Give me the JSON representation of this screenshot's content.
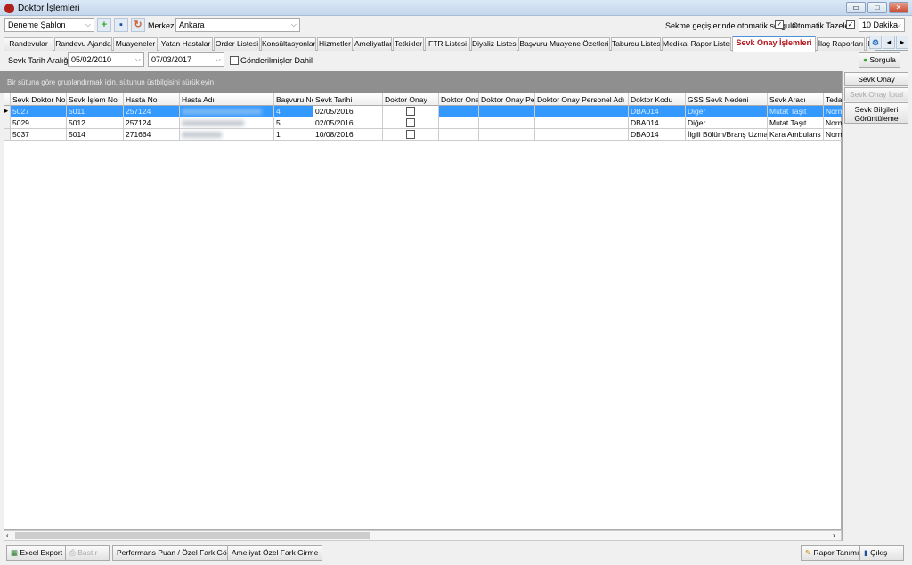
{
  "window": {
    "title": "Doktor İşlemleri",
    "minimize": "▭",
    "maximize": "□",
    "close": "✕"
  },
  "toolbar": {
    "template": "Deneme Şablon",
    "merkez_label": "Merkez:",
    "merkez_value": "Ankara",
    "auto_query_label": "Sekme geçişlerinde otomatik sorgula",
    "auto_query_checked": true,
    "auto_refresh_label": "Otomatik Tazele",
    "auto_refresh_checked": true,
    "refresh_interval": "10 Dakika"
  },
  "tabs": [
    "Randevular",
    "Randevu Ajanda",
    "Muayeneler",
    "Yatan Hastalar",
    "Order Listesi",
    "Konsültasyonlar",
    "Hizmetler",
    "Ameliyatlar",
    "Tetkikler",
    "FTR Listesi",
    "Diyaliz Listesi",
    "Başvuru Muayene Özetleri",
    "Taburcu Listesi",
    "Medikal Rapor Listesi",
    "Sevk Onay İşlemleri",
    "İlaç Raporları",
    "P"
  ],
  "active_tab": "Sevk Onay İşlemleri",
  "filter": {
    "label": "Sevk Tarih Aralığı:",
    "start": "05/02/2010",
    "end": "07/03/2017",
    "include_sent_label": "Gönderilmişler Dahil",
    "include_sent": false,
    "query_button": "Sorgula"
  },
  "group_hint": "Bir sütuna göre gruplandırmak için, sütunun üstbilgisini sürükleyin",
  "grid": {
    "columns": [
      "Sevk Doktor No",
      "Sevk İşlem No",
      "Hasta No",
      "Hasta Adı",
      "Başvuru No",
      "Sevk Tarihi",
      "Doktor Onay",
      "Doktor Onay",
      "Doktor Onay Pers",
      "Doktor Onay Personel Adı",
      "Doktor Kodu",
      "GSS Sevk Nedeni",
      "Sevk Aracı",
      "Teda"
    ],
    "rows": [
      [
        "5027",
        "5011",
        "257124",
        "",
        "4",
        "02/05/2016",
        "",
        "",
        "",
        "",
        "DBA014",
        "Diğer",
        "Mutat Taşıt",
        "Norm"
      ],
      [
        "5029",
        "5012",
        "257124",
        "",
        "5",
        "02/05/2016",
        "",
        "",
        "",
        "",
        "DBA014",
        "Diğer",
        "Mutat Taşıt",
        "Norm"
      ],
      [
        "5037",
        "5014",
        "271664",
        "",
        "1",
        "10/08/2016",
        "",
        "",
        "",
        "",
        "DBA014",
        "İlgili Bölüm/Branş Uzmanı B",
        "Kara Ambulans",
        "Norm"
      ]
    ],
    "selected_row": 0
  },
  "side_buttons": {
    "approve": "Sevk Onay",
    "cancel": "Sevk Onay İptal",
    "view": "Sevk Bilgileri Görüntüleme"
  },
  "bottom": {
    "excel": "Excel Export",
    "print": "Bastır",
    "performance": "Performans Puan / Özel Fark Gör.",
    "surgery": "Ameliyat Özel Fark Girme",
    "report": "Rapor Tanımı",
    "exit": "Çıkış"
  }
}
